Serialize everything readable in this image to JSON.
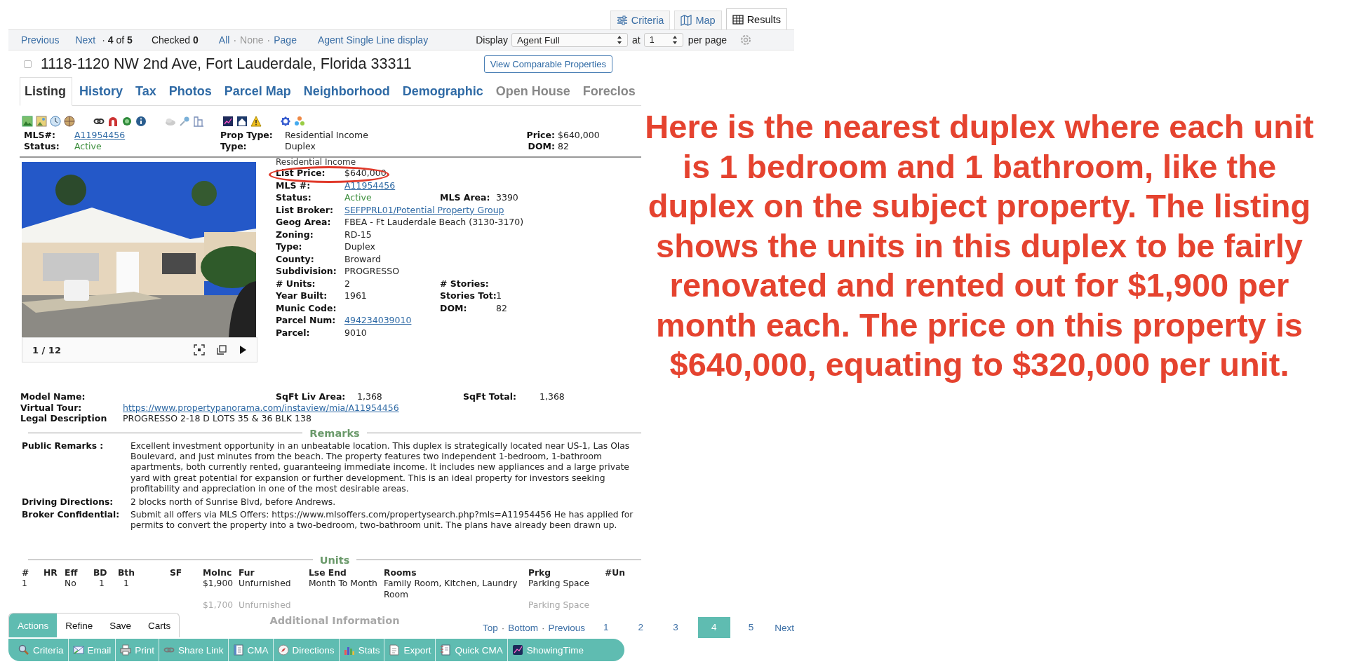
{
  "view_tabs": [
    {
      "label": "Criteria",
      "selected": false
    },
    {
      "label": "Map",
      "selected": false
    },
    {
      "label": "Results",
      "selected": true
    }
  ],
  "toolbar": {
    "previous": "Previous",
    "next": "Next",
    "position": "· **4** of **5**",
    "checked": "Checked **0**",
    "select_links": [
      {
        "label": "All",
        "disabled": false
      },
      {
        "label": "None",
        "disabled": true
      },
      {
        "label": "Page",
        "disabled": false
      }
    ],
    "separator": "·",
    "single_line": "Agent Single Line display",
    "display_label": "Display",
    "display_value": "Agent Full",
    "at_label": "at",
    "per_page_value": "1",
    "per_page_label": "per page"
  },
  "listing": {
    "checked": false,
    "address": "1118-1120 NW 2nd Ave, Fort Lauderdale, Florida 33311",
    "comparable_button": "View Comparable Properties",
    "tabs": [
      {
        "label": "Listing",
        "selected": true,
        "disabled": false
      },
      {
        "label": "History",
        "selected": false,
        "disabled": false
      },
      {
        "label": "Tax",
        "selected": false,
        "disabled": false
      },
      {
        "label": "Photos",
        "selected": false,
        "disabled": false
      },
      {
        "label": "Parcel Map",
        "selected": false,
        "disabled": false
      },
      {
        "label": "Neighborhood",
        "selected": false,
        "disabled": false
      },
      {
        "label": "Demographic",
        "selected": false,
        "disabled": false
      },
      {
        "label": "Open House",
        "selected": false,
        "disabled": true
      },
      {
        "label": "Foreclos",
        "selected": false,
        "disabled": true
      }
    ]
  },
  "summary": [
    {
      "rows": [
        {
          "label": "MLS#:",
          "value": "A11954456",
          "kind": "link"
        },
        {
          "label": "Status:",
          "value": "Active",
          "kind": "status"
        }
      ]
    },
    {
      "rows": [
        {
          "label": "Prop Type:",
          "value": "Residential Income",
          "kind": "text"
        },
        {
          "label": "Type:",
          "value": "Duplex",
          "kind": "text"
        }
      ]
    },
    {
      "rows": [
        {
          "label": "Price:",
          "value": "$640,000",
          "kind": "text"
        },
        {
          "label": "DOM:",
          "value": "82",
          "kind": "text"
        }
      ]
    }
  ],
  "photo": {
    "counter": "1 / 12"
  },
  "details": {
    "category": "Residential Income",
    "rows": [
      {
        "label": "List Price:",
        "value": "$640,000",
        "kind": "text"
      },
      {
        "label": "MLS #:",
        "value": "A11954456",
        "kind": "link"
      },
      {
        "label": "Status:",
        "value": "Active",
        "kind": "status",
        "label2": "MLS Area:",
        "value2": "3390"
      },
      {
        "label": "List Broker:",
        "value": "SEFPPRL01/Potential Property Group",
        "kind": "link"
      },
      {
        "label": "Geog Area:",
        "value": "FBEA - Ft Lauderdale Beach (3130-3170)",
        "kind": "text"
      },
      {
        "label": "Zoning:",
        "value": "RD-15",
        "kind": "text"
      },
      {
        "label": "Type:",
        "value": "Duplex",
        "kind": "text"
      },
      {
        "label": "County:",
        "value": "Broward",
        "kind": "text"
      },
      {
        "label": "Subdivision:",
        "value": "PROGRESSO",
        "kind": "text"
      },
      {
        "label": "# Units:",
        "value": "2",
        "kind": "text",
        "label2": "# Stories:"
      },
      {
        "label": "Year Built:",
        "value": "1961",
        "kind": "text",
        "label2": "Stories Tot:",
        "value2": "1"
      },
      {
        "label": "Munic Code:",
        "label2": "DOM:",
        "value2": "82"
      },
      {
        "label": "Parcel Num:",
        "value": "494234039010",
        "kind": "link"
      },
      {
        "label": "Parcel:",
        "value": "9010",
        "kind": "text"
      }
    ]
  },
  "facts": [
    {
      "label": "Model Name:",
      "label2": "SqFt Liv Area:",
      "value2": "1,368",
      "label3": "SqFt Total:",
      "value3": "1,368"
    },
    {
      "label": "Virtual Tour:",
      "value": "https://www.propertypanorama.com/instaview/mia/A11954456",
      "kind": "link"
    },
    {
      "label": "Legal Description",
      "value": "PROGRESSO 2-18 D LOTS 35 & 36 BLK 138",
      "kind": "text"
    }
  ],
  "remarks": {
    "title": "Remarks",
    "items": [
      {
        "label": "Public Remarks :",
        "value": "Excellent investment opportunity in an unbeatable location. This duplex is strategically located near US-1, Las Olas Boulevard, and just minutes from the beach. The property features two independent 1-bedroom, 1-bathroom apartments, both currently rented, guaranteeing immediate income. It includes new appliances and a large private yard with great potential for expansion or further development. This is an ideal property for investors seeking profitability and appreciation in one of the most desirable areas."
      },
      {
        "label": "Driving Directions:",
        "value": "2 blocks north of Sunrise Blvd, before Andrews."
      },
      {
        "label": "Broker Confidential:",
        "value": "Submit all offers via MLS Offers: https://www.mlsoffers.com/propertysearch.php?mls=A11954456 He has applied for permits to convert the property into a two-bedroom, two-bathroom unit. The plans have already been drawn up."
      }
    ]
  },
  "units": {
    "title": "Units",
    "columns": [
      "#",
      "HR",
      "Eff",
      "BD",
      "Bth",
      "SF",
      "MoInc",
      "Fur",
      "Lse End",
      "Rooms",
      "Prkg",
      "#Un"
    ],
    "rows": [
      {
        "faded": false,
        "cells": [
          "1",
          null,
          "No",
          "1",
          "1",
          null,
          "$1,900",
          "Unfurnished",
          "Month To Month",
          "Family Room, Kitchen, Laundry Room",
          "Parking Space",
          null
        ]
      },
      {
        "faded": true,
        "cells": [
          null,
          null,
          null,
          null,
          null,
          null,
          "$1,700",
          "Unfurnished",
          null,
          null,
          "Parking Space",
          null
        ]
      }
    ]
  },
  "additional": {
    "title": "Additional Information"
  },
  "action_bar": {
    "tabs": [
      {
        "label": "Actions",
        "selected": true
      },
      {
        "label": "Refine",
        "selected": false
      },
      {
        "label": "Save",
        "selected": false
      },
      {
        "label": "Carts",
        "selected": false
      }
    ],
    "buttons": [
      "Criteria",
      "Email",
      "Print",
      "Share Link",
      "CMA",
      "Directions",
      "Stats",
      "Export",
      "Quick CMA",
      "ShowingTime"
    ]
  },
  "pagination": {
    "top": "Top",
    "bottom": "Bottom",
    "separator": "·",
    "previous": "Previous",
    "next": "Next",
    "pages": [
      {
        "label": "1",
        "selected": false
      },
      {
        "label": "2",
        "selected": false
      },
      {
        "label": "3",
        "selected": false
      },
      {
        "label": "4",
        "selected": true
      },
      {
        "label": "5",
        "selected": false
      }
    ]
  },
  "annotation": {
    "text": "Here is the nearest duplex where each unit is 1 bedroom and 1 bathroom, like the duplex on the subject property. The listing shows the units in this duplex to be fairly renovated and rented out for $1,900 per month each. The price on this property is $640,000, equating to $320,000 per unit."
  }
}
